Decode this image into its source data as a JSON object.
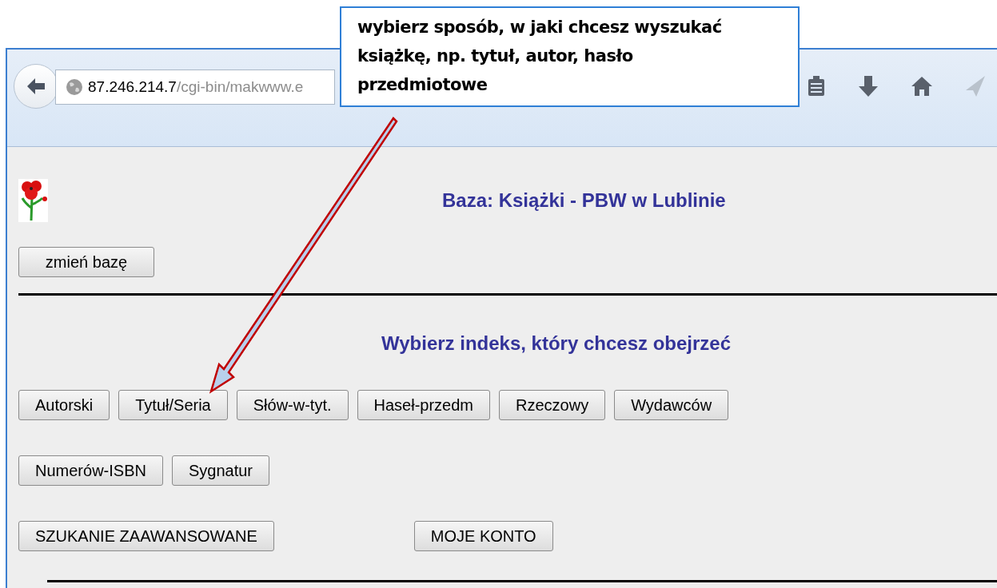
{
  "browser": {
    "url_host": "87.246.214.7",
    "url_path": "/cgi-bin/makwww.e"
  },
  "callout": {
    "text": "wybierz sposób, w jaki chcesz wyszukać książkę, np. tytuł, autor, hasło przedmiotowe"
  },
  "page": {
    "title": "Baza: Książki - PBW w Lublinie",
    "change_db_button": "zmień bazę",
    "heading": "Wybierz indeks, który chcesz obejrzeć",
    "index_rows": [
      [
        "Autorski",
        "Tytuł/Seria",
        "Słów-w-tyt.",
        "Haseł-przedm",
        "Rzeczowy",
        "Wydawców"
      ],
      [
        "Numerów-ISBN",
        "Sygnatur"
      ]
    ],
    "bottom_buttons": [
      "SZUKANIE ZAAWANSOWANE",
      "MOJE KONTO"
    ]
  }
}
